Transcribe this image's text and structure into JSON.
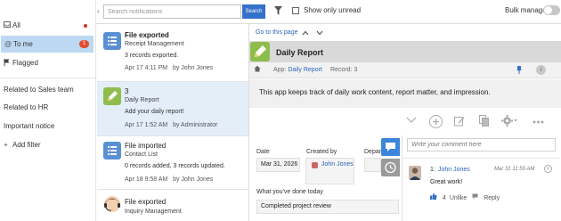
{
  "sidebar": {
    "items": [
      {
        "label": "All",
        "icon": "inbox-icon"
      },
      {
        "label": "To me",
        "icon": "at-icon",
        "badge": "1"
      },
      {
        "label": "Flagged",
        "icon": "flag-icon"
      },
      {
        "label": "Related to Sales team"
      },
      {
        "label": "Related to HR"
      },
      {
        "label": "Important notice"
      },
      {
        "label": "Add filter",
        "icon": "plus-icon"
      }
    ]
  },
  "header": {
    "search_placeholder": "Search notifications",
    "search_button": "Search",
    "show_unread_label": "Show only unread",
    "bulk_manage_label": "Bulk manage"
  },
  "notifications": [
    {
      "title": "File exported",
      "app": "Receipt Management",
      "message": "3 records exported.",
      "time": "Apr 17 4:11 PM",
      "by": "by John Jones",
      "bold": true
    },
    {
      "title": "3",
      "app": "Daily Report",
      "message": "Add your daily report!",
      "time": "Apr 17 1:52 AM",
      "by": "by Administrator"
    },
    {
      "title": "File imported",
      "app": "Contact List",
      "message": "0 records added, 3 records updated.",
      "time": "Apr 18 9:58 AM",
      "by": "by John Jones"
    },
    {
      "title": "File exported",
      "app": "Inquiry Management",
      "message": "",
      "time": "",
      "by": ""
    }
  ],
  "detail": {
    "goto_label": "Go to this page",
    "app_title": "Daily Report",
    "breadcrumb_app_prefix": "App:",
    "breadcrumb_app": "Daily Report",
    "breadcrumb_record": "Record: 3",
    "description": "This app keeps track of daily work content, report matter, and impression.",
    "fields": {
      "date_label": "Date",
      "date_value": "Mar 31, 2026",
      "created_by_label": "Created by",
      "created_by_value": "John Jones",
      "department_label": "Depar",
      "done_today_label": "What you've done today",
      "done_today_value": "Completed project review"
    },
    "comments": {
      "placeholder": "Write your comment here",
      "items": [
        {
          "num": "1:",
          "author": "John Jones",
          "time": "Mar 31 11:55 AM",
          "body": "Great work!",
          "likes": "4",
          "unlike": "Unlike",
          "reply": "Reply"
        }
      ]
    }
  },
  "colors": {
    "accent": "#3471c9",
    "selected_row": "#e3eef9",
    "sidebar_active": "#bcd8f2",
    "app_blue": "#5b8fd4",
    "app_green": "#8ebd4e"
  }
}
